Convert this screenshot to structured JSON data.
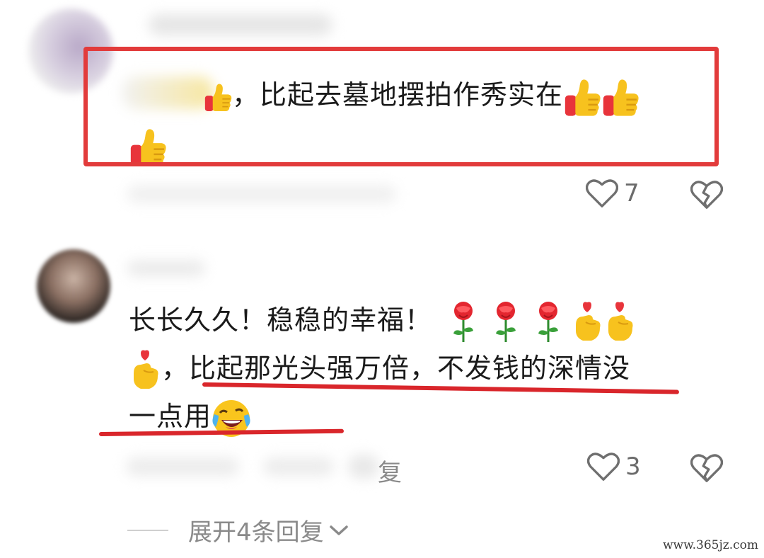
{
  "comments": [
    {
      "line1": "，比起去墓地摆拍作秀实在",
      "like_count": "7"
    },
    {
      "line1": "长长久久！稳稳的幸福！",
      "line2": "，比起那光头强万倍，不发钱的深情没",
      "line3": "一点用",
      "reply_fragment": "复",
      "like_count": "3"
    }
  ],
  "expand_replies_label": "展开4条回复",
  "watermark": "www.365jz.com",
  "icons": {
    "like": "heart-outline-icon",
    "dislike": "broken-heart-icon",
    "thumbs_up": "thumbs-up-emoji-icon",
    "rose": "rose-emoji-icon",
    "finger_heart": "finger-heart-emoji-icon",
    "laugh_cry": "rofl-emoji-icon",
    "chevron": "chevron-down-icon"
  },
  "colors": {
    "highlight": "#e23b3b",
    "underline": "#d9262b",
    "meta_text": "#8a8a8a"
  }
}
